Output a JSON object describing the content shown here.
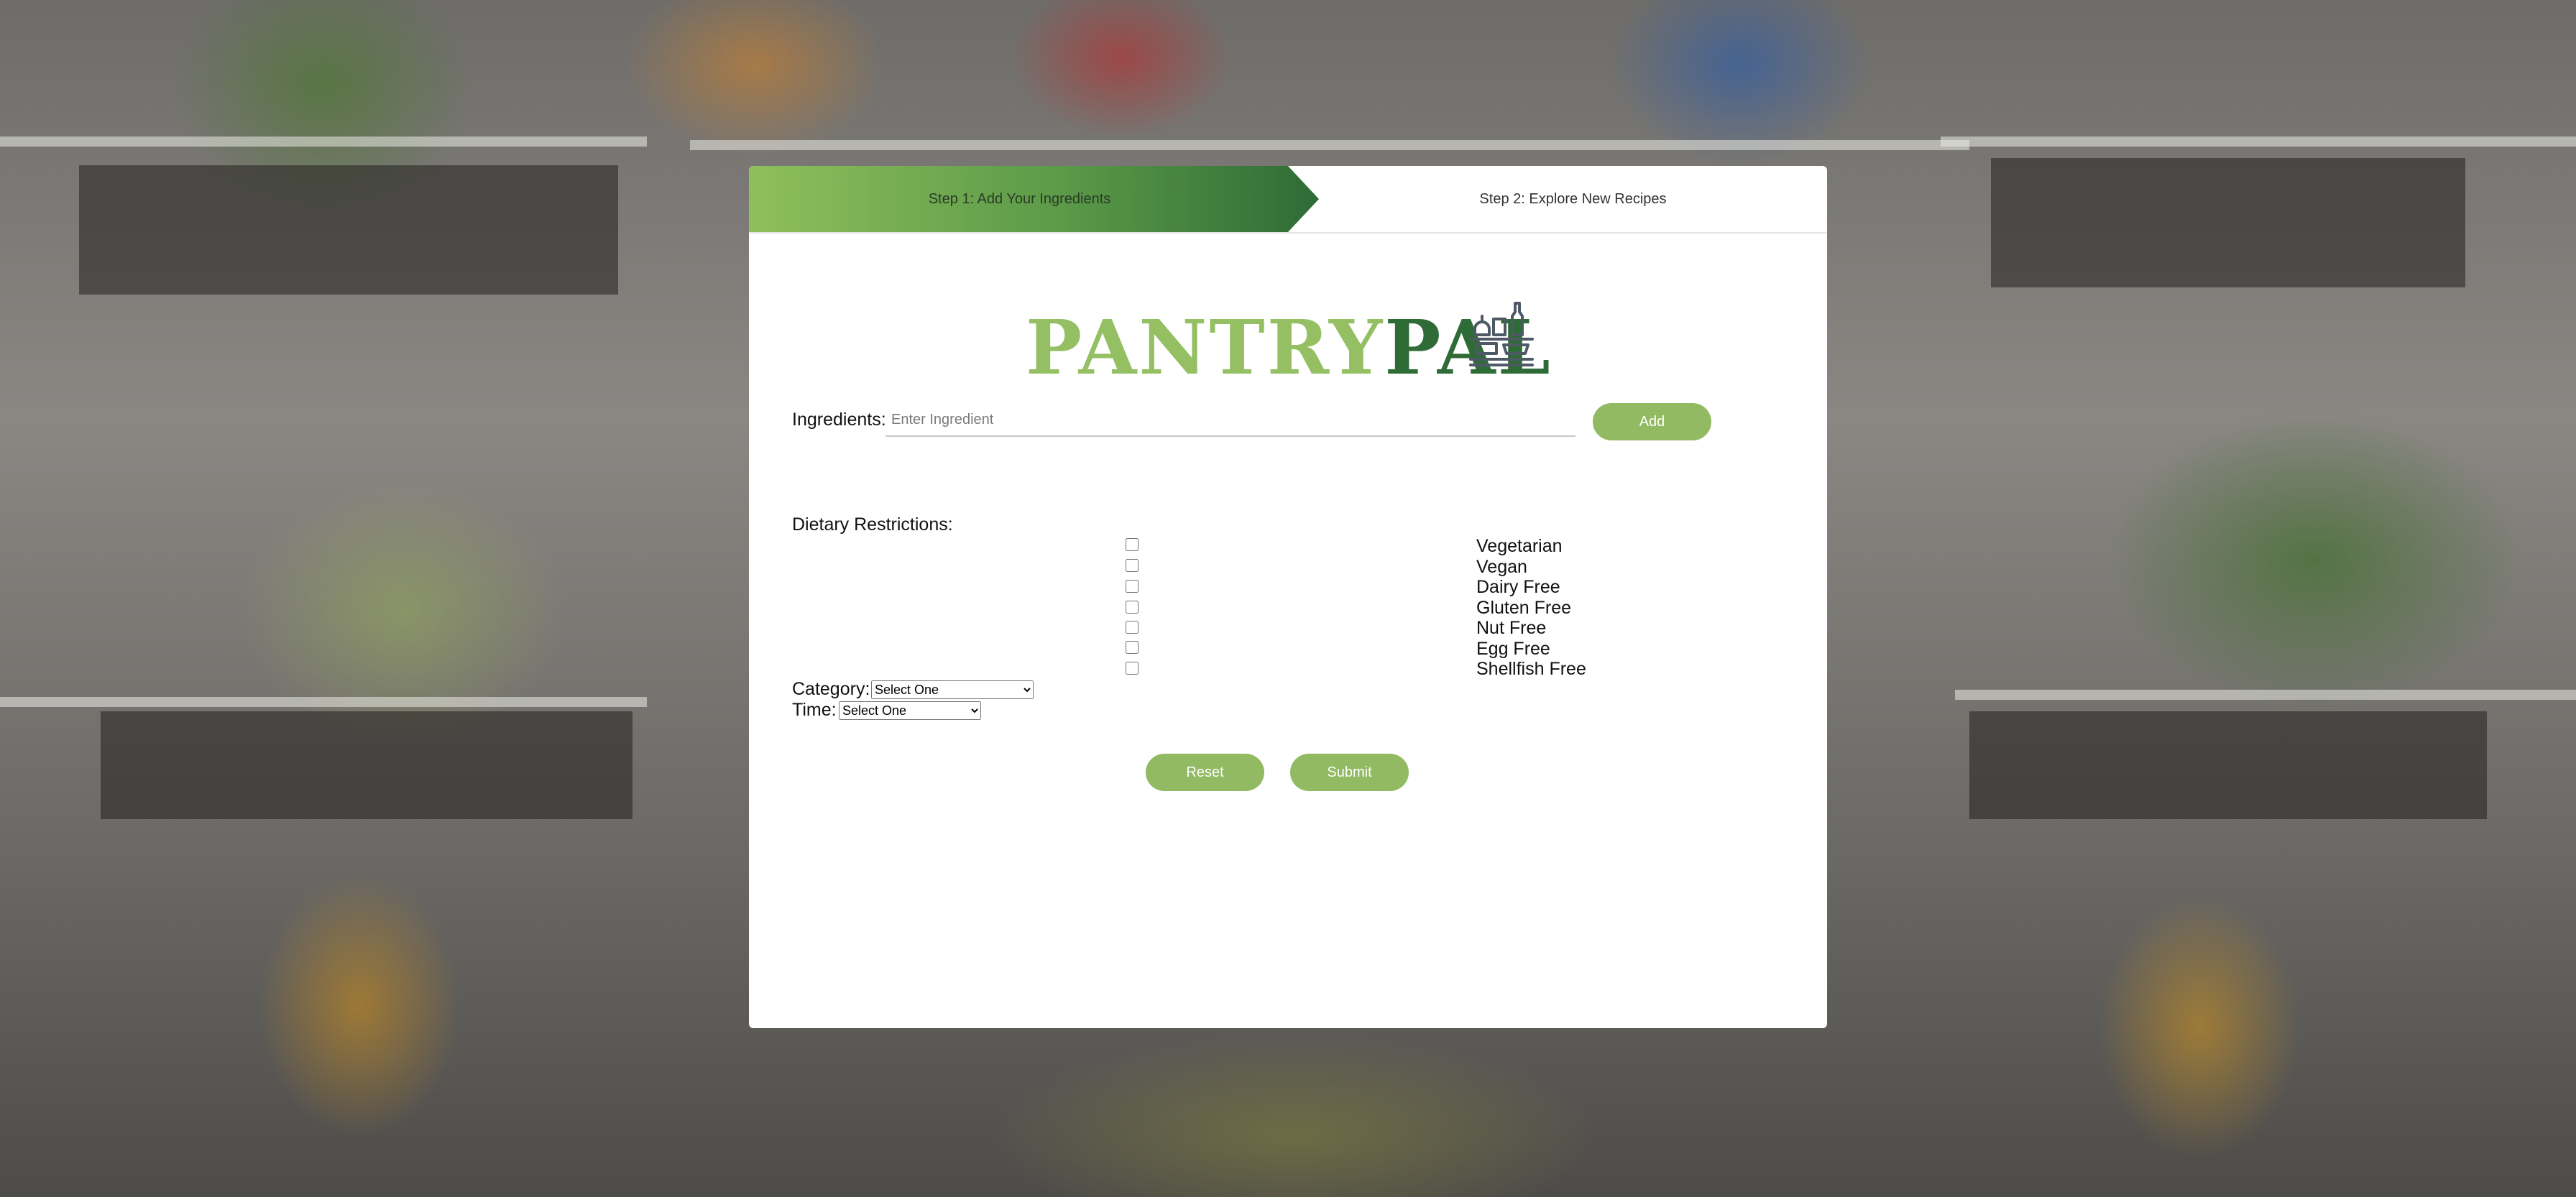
{
  "steps": {
    "step1": "Step 1: Add Your Ingredients",
    "step2": "Step 2: Explore New Recipes"
  },
  "logo": {
    "part1": "PANTRY",
    "part2": "PAL",
    "icon": "pantry-shelf-icon"
  },
  "ingredients": {
    "label": "Ingredients:",
    "placeholder": "Enter Ingredient",
    "value": "",
    "add_label": "Add"
  },
  "dietary": {
    "label": "Dietary Restrictions:",
    "options": [
      {
        "label": "Vegetarian",
        "checked": false
      },
      {
        "label": "Vegan",
        "checked": false
      },
      {
        "label": "Dairy Free",
        "checked": false
      },
      {
        "label": "Gluten Free",
        "checked": false
      },
      {
        "label": "Nut Free",
        "checked": false
      },
      {
        "label": "Egg Free",
        "checked": false
      },
      {
        "label": "Shellfish Free",
        "checked": false
      }
    ]
  },
  "category": {
    "label": "Category:",
    "selected": "Select One"
  },
  "time": {
    "label": "Time:",
    "selected": "Select One"
  },
  "actions": {
    "reset_label": "Reset",
    "submit_label": "Submit"
  },
  "colors": {
    "primary_green": "#92ba62",
    "dark_green": "#2f6b36",
    "light_green": "#94bf62"
  }
}
